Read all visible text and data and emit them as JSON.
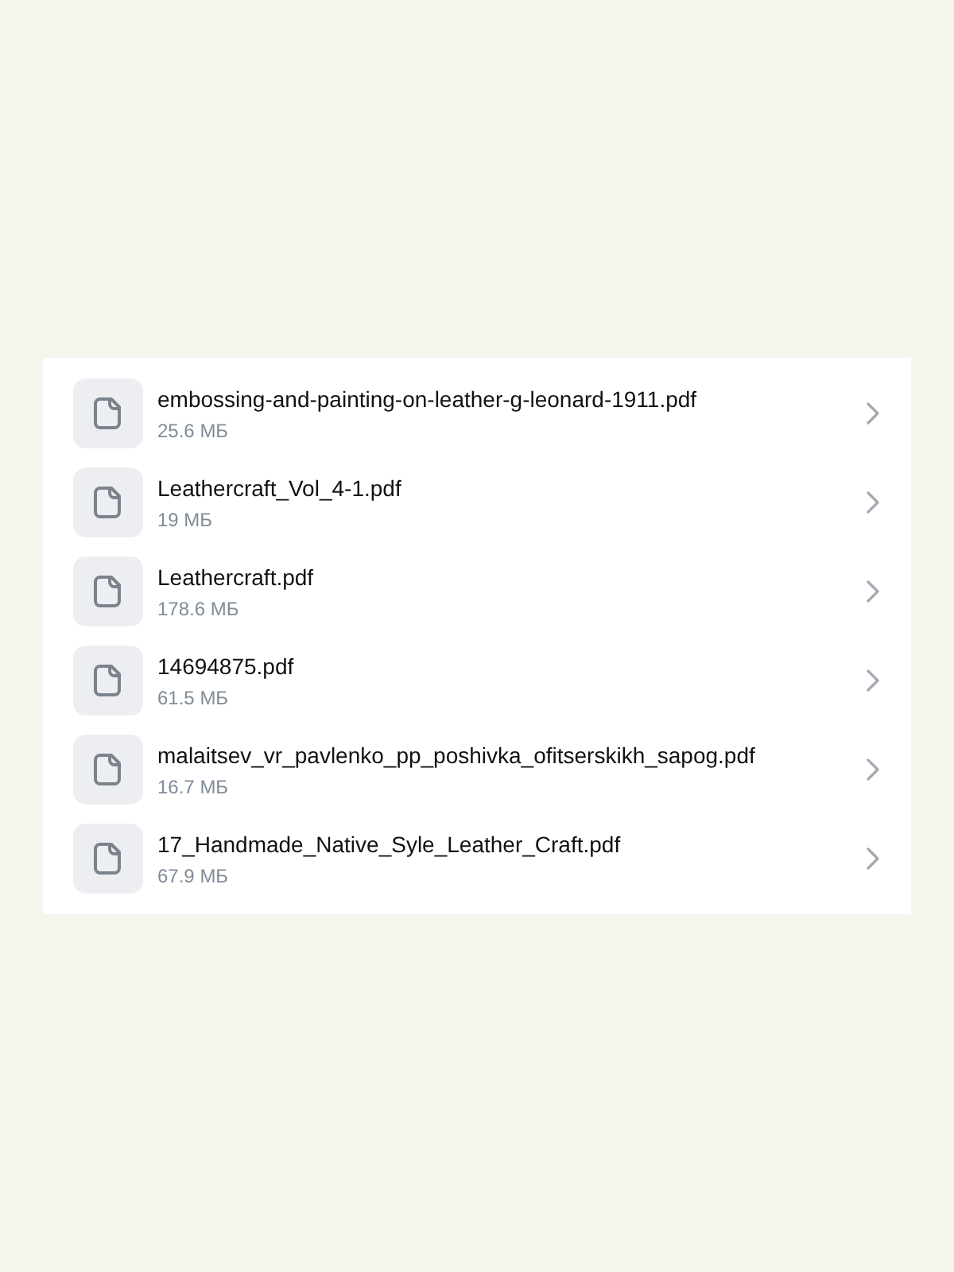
{
  "files": [
    {
      "name": "embossing-and-painting-on-leather-g-leonard-1911.pdf",
      "size": "25.6 МБ"
    },
    {
      "name": "Leathercraft_Vol_4-1.pdf",
      "size": "19 МБ"
    },
    {
      "name": "Leathercraft.pdf",
      "size": "178.6 МБ"
    },
    {
      "name": "14694875.pdf",
      "size": "61.5 МБ"
    },
    {
      "name": "malaitsev_vr_pavlenko_pp_poshivka_ofitserskikh_sapog.pdf",
      "size": "16.7 МБ"
    },
    {
      "name": "17_Handmade_Native_Syle_Leather_Craft.pdf",
      "size": "67.9 МБ"
    }
  ]
}
